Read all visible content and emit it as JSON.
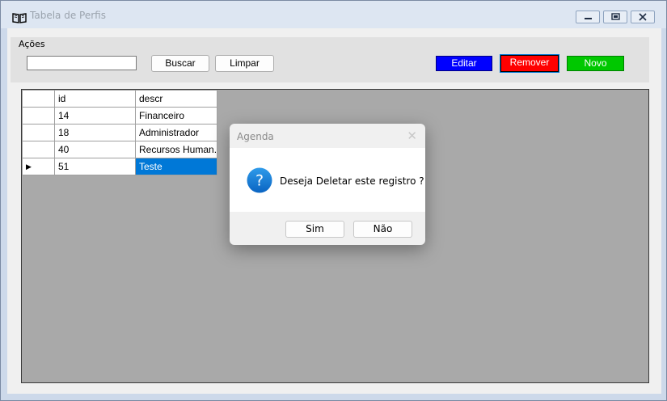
{
  "window": {
    "title": "Tabela de Perfis"
  },
  "actions_group": {
    "label": "Ações",
    "search_value": "",
    "buscar_label": "Buscar",
    "limpar_label": "Limpar",
    "editar_label": "Editar",
    "remover_label": "Remover",
    "novo_label": "Novo"
  },
  "colors": {
    "editar": "#0000ff",
    "remover": "#ff0000",
    "novo": "#00c800",
    "selection": "#0078d7"
  },
  "grid": {
    "columns": [
      "id",
      "descr"
    ],
    "rows": [
      {
        "id": "14",
        "descr": "Financeiro"
      },
      {
        "id": "18",
        "descr": "Administrador"
      },
      {
        "id": "40",
        "descr": "Recursos Human..."
      },
      {
        "id": "51",
        "descr": "Teste"
      }
    ],
    "current_row_marker": "▶"
  },
  "dialog": {
    "title": "Agenda",
    "message": "Deseja Deletar este registro ?",
    "icon": "question-icon",
    "yes_label": "Sim",
    "no_label": "Não"
  }
}
